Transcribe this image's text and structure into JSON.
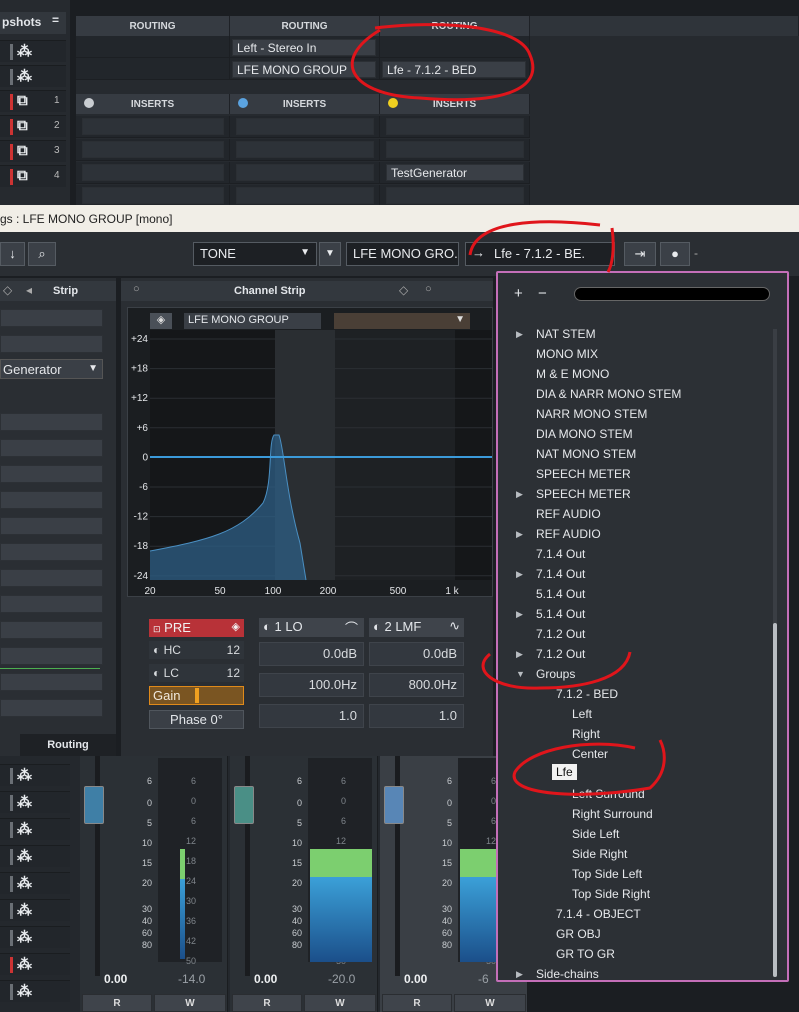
{
  "left_top": {
    "header": "pshots",
    "eq_icon": "=",
    "tracks": [
      {
        "num": "",
        "red": false
      },
      {
        "num": "",
        "red": false
      },
      {
        "num": "1",
        "red": true
      },
      {
        "num": "2",
        "red": true
      },
      {
        "num": "3",
        "red": true
      },
      {
        "num": "4",
        "red": true
      }
    ]
  },
  "routing": {
    "headers": [
      "ROUTING",
      "ROUTING",
      "ROUTING"
    ],
    "row1": [
      "",
      "Left - Stereo In",
      ""
    ],
    "row2": [
      "",
      "LFE MONO GROUP",
      "Lfe - 7.1.2 - BED"
    ],
    "inserts_headers": [
      "INSERTS",
      "INSERTS",
      "INSERTS"
    ],
    "insert_slot": "TestGenerator"
  },
  "title_bar": "gs : LFE MONO GROUP [mono]",
  "toolbar": {
    "preset": "TONE",
    "input": "LFE MONO GRO.",
    "output": "Lfe - 7.1.2 - BE.",
    "separator": "-"
  },
  "left_panel": {
    "tab_strip": "Strip",
    "tab_routing": "Routing",
    "generator": "Generator"
  },
  "channel_strip": {
    "title": "Channel Strip",
    "eq_name": "LFE MONO GROUP",
    "y_ticks": [
      "+24",
      "+18",
      "+12",
      "+6",
      "0",
      "-6",
      "-12",
      "-18",
      "-24"
    ],
    "x_ticks": [
      "20",
      "50",
      "100",
      "200",
      "500",
      "1 k"
    ],
    "pre": "PRE",
    "hc": "HC",
    "lc": "LC",
    "gain": "Gain",
    "phase": "Phase 0°",
    "hc_val": "12",
    "lc_val": "12",
    "band1": {
      "name": "1 LO",
      "gain": "0.0dB",
      "freq": "100.0Hz",
      "q": "1.0"
    },
    "band2": {
      "name": "2 LMF",
      "gain": "0.0dB",
      "freq": "800.0Hz",
      "q": "1.0"
    }
  },
  "mixer": {
    "scale": [
      "6",
      "0",
      "5",
      "10",
      "15",
      "20",
      "30",
      "40",
      "60",
      "80"
    ],
    "meter_scale": [
      "6",
      "0",
      "6",
      "12",
      "18",
      "24",
      "30",
      "36",
      "42",
      "50"
    ],
    "channels": [
      {
        "vol": "0.00",
        "peak": "-14.0"
      },
      {
        "vol": "0.00",
        "peak": "-20.0"
      },
      {
        "vol": "0.00",
        "peak": "-6"
      }
    ],
    "r": "R",
    "w": "W"
  },
  "popup": {
    "plus": "+",
    "minus": "−",
    "items": [
      {
        "t": "NAT STEM",
        "lvl": 1,
        "arrow": true
      },
      {
        "t": "MONO MIX",
        "lvl": 1
      },
      {
        "t": "M & E MONO",
        "lvl": 1
      },
      {
        "t": "DIA & NARR MONO STEM",
        "lvl": 1
      },
      {
        "t": "NARR MONO STEM",
        "lvl": 1
      },
      {
        "t": "DIA MONO STEM",
        "lvl": 1
      },
      {
        "t": "NAT MONO STEM",
        "lvl": 1
      },
      {
        "t": "SPEECH METER",
        "lvl": 1
      },
      {
        "t": "SPEECH METER",
        "lvl": 1,
        "arrow": true
      },
      {
        "t": "REF AUDIO",
        "lvl": 1
      },
      {
        "t": "REF AUDIO",
        "lvl": 1,
        "arrow": true
      },
      {
        "t": "7.1.4 Out",
        "lvl": 1
      },
      {
        "t": "7.1.4 Out",
        "lvl": 1,
        "arrow": true
      },
      {
        "t": "5.1.4 Out",
        "lvl": 1
      },
      {
        "t": "5.1.4 Out",
        "lvl": 1,
        "arrow": true
      },
      {
        "t": "7.1.2 Out",
        "lvl": 1
      },
      {
        "t": "7.1.2 Out",
        "lvl": 1,
        "arrow": true
      },
      {
        "t": "Groups",
        "lvl": 1,
        "open": true
      },
      {
        "t": "7.1.2 - BED",
        "lvl": 2
      },
      {
        "t": "Left",
        "lvl": 3
      },
      {
        "t": "Right",
        "lvl": 3
      },
      {
        "t": "Center",
        "lvl": 3
      },
      {
        "t": "Lfe",
        "lvl": 3,
        "selected": true
      },
      {
        "t": "Left Surround",
        "lvl": 3
      },
      {
        "t": "Right Surround",
        "lvl": 3
      },
      {
        "t": "Side Left",
        "lvl": 3
      },
      {
        "t": "Side Right",
        "lvl": 3
      },
      {
        "t": "Top Side Left",
        "lvl": 3
      },
      {
        "t": "Top Side Right",
        "lvl": 3
      },
      {
        "t": "7.1.4 - OBJECT",
        "lvl": 2
      },
      {
        "t": "GR OBJ",
        "lvl": 2
      },
      {
        "t": "GR TO GR",
        "lvl": 2
      },
      {
        "t": "Side-chains",
        "lvl": 1,
        "arrow": true
      }
    ]
  },
  "colors": {
    "annotation": "#e0151b",
    "popup_border": "#c46fb9",
    "eq_line": "#3b9ad9",
    "pre_red": "#b83238",
    "gain_orange": "#e08a1a"
  }
}
